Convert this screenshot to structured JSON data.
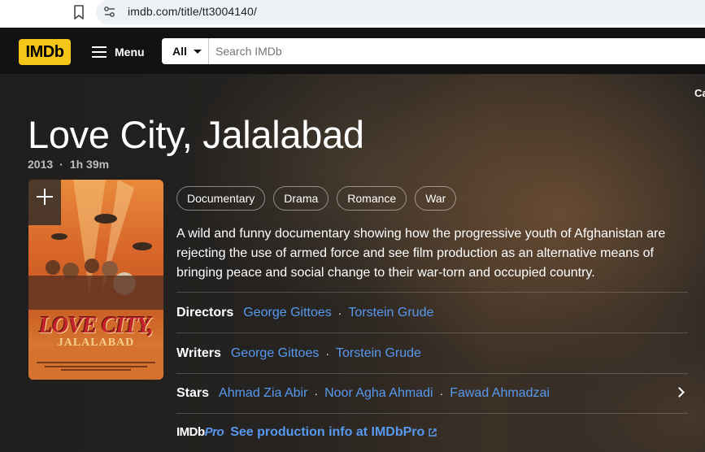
{
  "browser": {
    "url": "imdb.com/title/tt3004140/"
  },
  "header": {
    "logo": "IMDb",
    "menu_label": "Menu",
    "search_category": "All",
    "search_placeholder": "Search IMDb"
  },
  "hero": {
    "cut_text": "Ca",
    "title": "Love City, Jalalabad",
    "year": "2013",
    "separator": "·",
    "runtime": "1h 39m"
  },
  "poster": {
    "title_text": "LOVE CITY,",
    "subtitle_text": "JALALABAD",
    "colors": {
      "top": "#e88a3a",
      "bottom": "#e59a4c",
      "title": "#c6222b"
    }
  },
  "genres": [
    "Documentary",
    "Drama",
    "Romance",
    "War"
  ],
  "plot": "A wild and funny documentary showing how the progressive youth of Afghanistan are rejecting the use of armed force and see film production as an alternative means of bringing peace and social change to their war-torn and occupied country.",
  "credits": {
    "directors": {
      "label": "Directors",
      "names": [
        "George Gittoes",
        "Torstein Grude"
      ]
    },
    "writers": {
      "label": "Writers",
      "names": [
        "George Gittoes",
        "Torstein Grude"
      ]
    },
    "stars": {
      "label": "Stars",
      "names": [
        "Ahmad Zia Abir",
        "Noor Agha Ahmadi",
        "Fawad Ahmadzai"
      ]
    },
    "dot": "·"
  },
  "imdbpro": {
    "logo_main": "IMDb",
    "logo_pro": "Pro",
    "link_text": "See production info at IMDbPro"
  },
  "colors": {
    "accent_yellow": "#f5c518",
    "link_blue": "#5799ef",
    "header_bg": "#121212"
  },
  "icons": [
    "bookmark-icon",
    "site-info-icon",
    "hamburger-icon",
    "caret-down-icon",
    "add-watchlist-icon",
    "chevron-right-icon",
    "external-link-icon"
  ]
}
